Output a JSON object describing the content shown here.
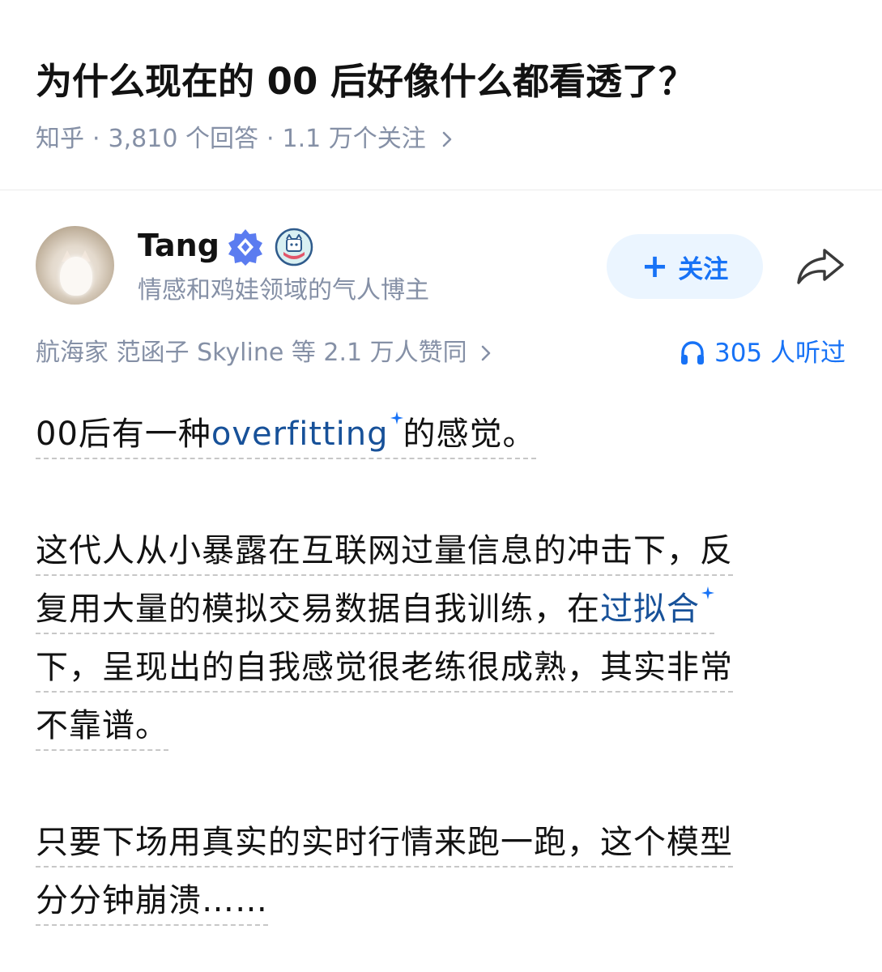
{
  "question": {
    "title": "为什么现在的 00 后好像什么都看透了？",
    "source": "知乎",
    "answers": "3,810 个回答",
    "followers": "1.1 万个关注",
    "dot": "·"
  },
  "author": {
    "name": "Tang",
    "bio": "情感和鸡娃领域的气人博主",
    "follow_label": "关注"
  },
  "stats": {
    "voters": "航海家 范函子 Skyline 等 2.1 万人赞同",
    "listened": "305 人听过"
  },
  "answer": {
    "p1": {
      "pre": "00后有一种",
      "keyword": "overfitting",
      "post": "的感觉。"
    },
    "p2": {
      "line1": "这代人从小暴露在互联网过量信息的冲击下，反",
      "line2_pre": "复用大量的模拟交易数据自我训练，在",
      "line2_keyword": "过拟合",
      "line3": "下，呈现出的自我感觉很老练很成熟，其实非常",
      "line4": "不靠谱。"
    },
    "p3": {
      "line1": "只要下场用真实的实时行情来跑一跑，这个模型",
      "line2": "分分钟崩溃……"
    }
  },
  "colors": {
    "brand_blue": "#1772f6",
    "keyword_blue": "#175199",
    "meta_gray": "#8590a6",
    "follow_bg": "#ebf5ff"
  },
  "icons": [
    "chevron-right-icon",
    "verified-badge-icon",
    "creator-badge-icon",
    "plus-icon",
    "share-icon",
    "headphone-icon",
    "sparkle-icon"
  ]
}
